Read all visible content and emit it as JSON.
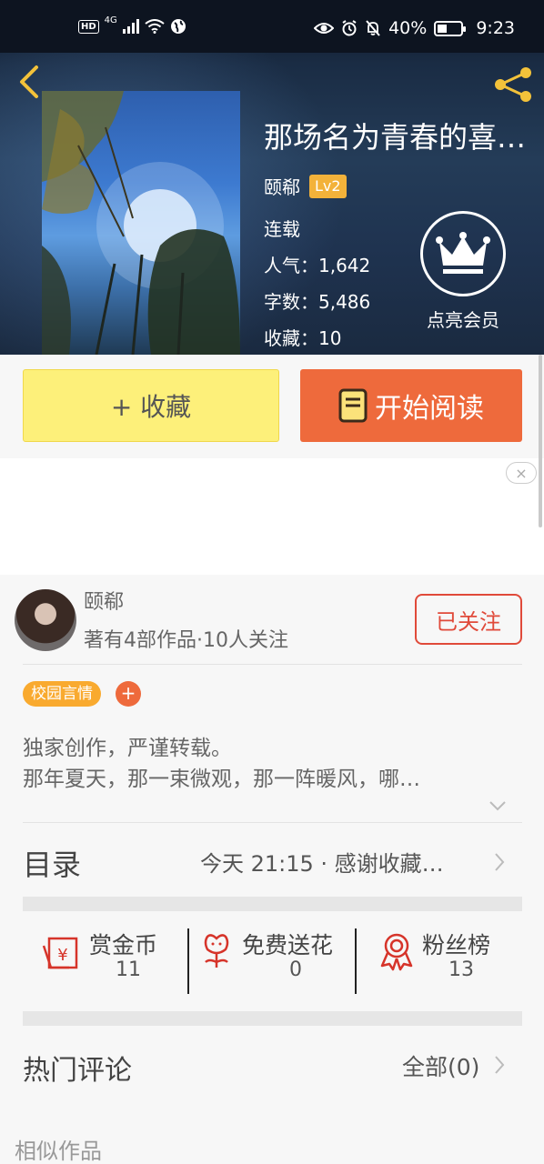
{
  "status_bar": {
    "network": "4G",
    "hd": "HD",
    "battery": "40%",
    "time": "9:23"
  },
  "book": {
    "title": "那场名为青春的喜…",
    "author": "颐郗",
    "level": "Lv2",
    "status": "连载",
    "popularity_label": "人气：",
    "popularity": "1,642",
    "words_label": "字数：",
    "words": "5,486",
    "favorites_label": "收藏：",
    "favorites": "10"
  },
  "member": {
    "label": "点亮会员"
  },
  "actions": {
    "favorite_label": "+ 收藏",
    "read_label": "开始阅读"
  },
  "author_card": {
    "name": "颐郗",
    "meta": "著有4部作品·10人关注",
    "follow_label": "已关注"
  },
  "tags": [
    "校园言情"
  ],
  "tag_add": "+",
  "description": [
    "独家创作，严谨转载。",
    "那年夏天，那一束微观，那一阵暖风，哪…"
  ],
  "toc": {
    "title": "目录",
    "latest": "今天 21:15 · 感谢收藏…"
  },
  "metrics": [
    {
      "label": "赏金币",
      "value": "11"
    },
    {
      "label": "免费送花",
      "value": "0"
    },
    {
      "label": "粉丝榜",
      "value": "13"
    }
  ],
  "comments": {
    "title": "热门评论",
    "all_label": "全部(0)"
  },
  "similar": {
    "title": "相似作品"
  }
}
